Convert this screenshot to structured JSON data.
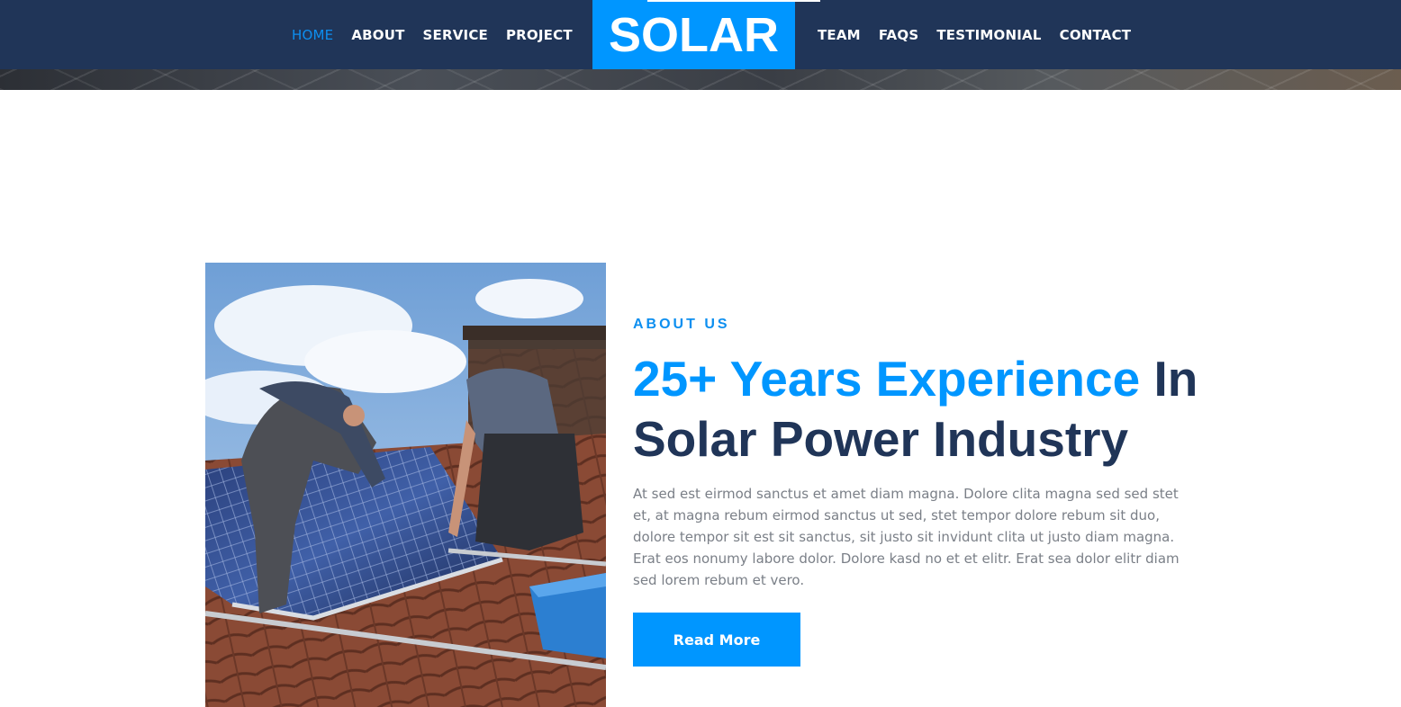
{
  "nav": {
    "left_items": [
      "HOME",
      "ABOUT",
      "SERVICE",
      "PROJECT"
    ],
    "right_items": [
      "TEAM",
      "FAQS",
      "TESTIMONIAL",
      "CONTACT"
    ],
    "active_item": "HOME",
    "brand": "SOLAR"
  },
  "about": {
    "eyebrow": "ABOUT US",
    "headline_accent": "25+ Years Experience",
    "headline_rest": " In Solar Power Industry",
    "body": "At sed est eirmod sanctus et amet diam magna. Dolore clita magna sed sed stet et, at magna rebum eirmod sanctus ut sed, stet tempor dolore rebum sit duo, dolore tempor sit est sit sanctus, sit justo sit invidunt clita ut justo diam magna. Erat eos nonumy labore dolor. Dolore kasd no et et elitr. Erat sea dolor elitr diam sed lorem rebum et vero.",
    "button_label": "Read More"
  },
  "colors": {
    "navy": "#203558",
    "accent_blue": "#0096ff",
    "body_text": "#7a7f87"
  }
}
